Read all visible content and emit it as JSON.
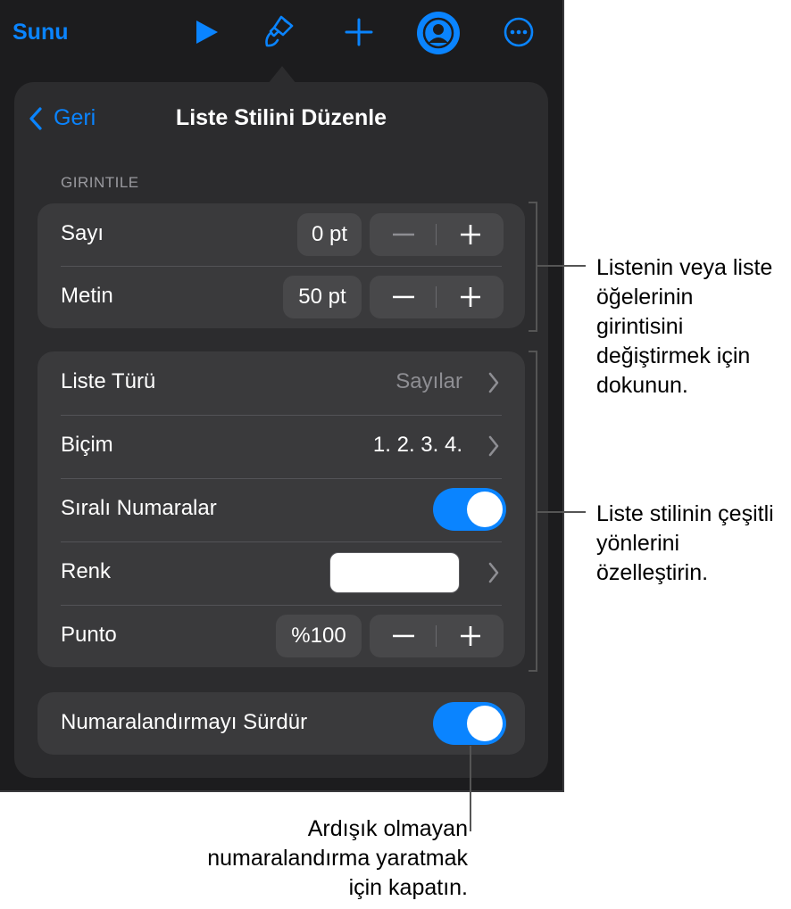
{
  "toolbar": {
    "title": "Sunu",
    "icons": [
      "play-icon",
      "paintbrush-icon",
      "plus-icon",
      "collaborate-icon",
      "more-icon"
    ]
  },
  "panel": {
    "back_label": "Geri",
    "title": "Liste Stilini Düzenle",
    "indent_section_label": "GIRINTILE",
    "indent_rows": [
      {
        "label": "Sayı",
        "value": "0 pt"
      },
      {
        "label": "Metin",
        "value": "50 pt"
      }
    ],
    "style_rows": {
      "list_type": {
        "label": "Liste Türü",
        "value": "Sayılar"
      },
      "format": {
        "label": "Biçim",
        "value": "1. 2. 3. 4."
      },
      "sequential": {
        "label": "Sıralı Numaralar",
        "on": true
      },
      "color": {
        "label": "Renk",
        "swatch": "#ffffff"
      },
      "size": {
        "label": "Punto",
        "value": "%100"
      }
    },
    "continue_row": {
      "label": "Numaralandırmayı Sürdür",
      "on": true
    }
  },
  "callouts": {
    "indent": "Listenin veya liste öğelerinin girintisini değiştirmek için dokunun.",
    "style": "Liste stilinin çeşitli yönlerini özelleştirin.",
    "continue": "Ardışık olmayan numaralandırma yaratmak için kapatın."
  },
  "colors": {
    "accent": "#0a84ff",
    "toggle_on": "#0a84ff",
    "panel_bg": "#2c2c2e",
    "group_bg": "#3a3a3c"
  }
}
